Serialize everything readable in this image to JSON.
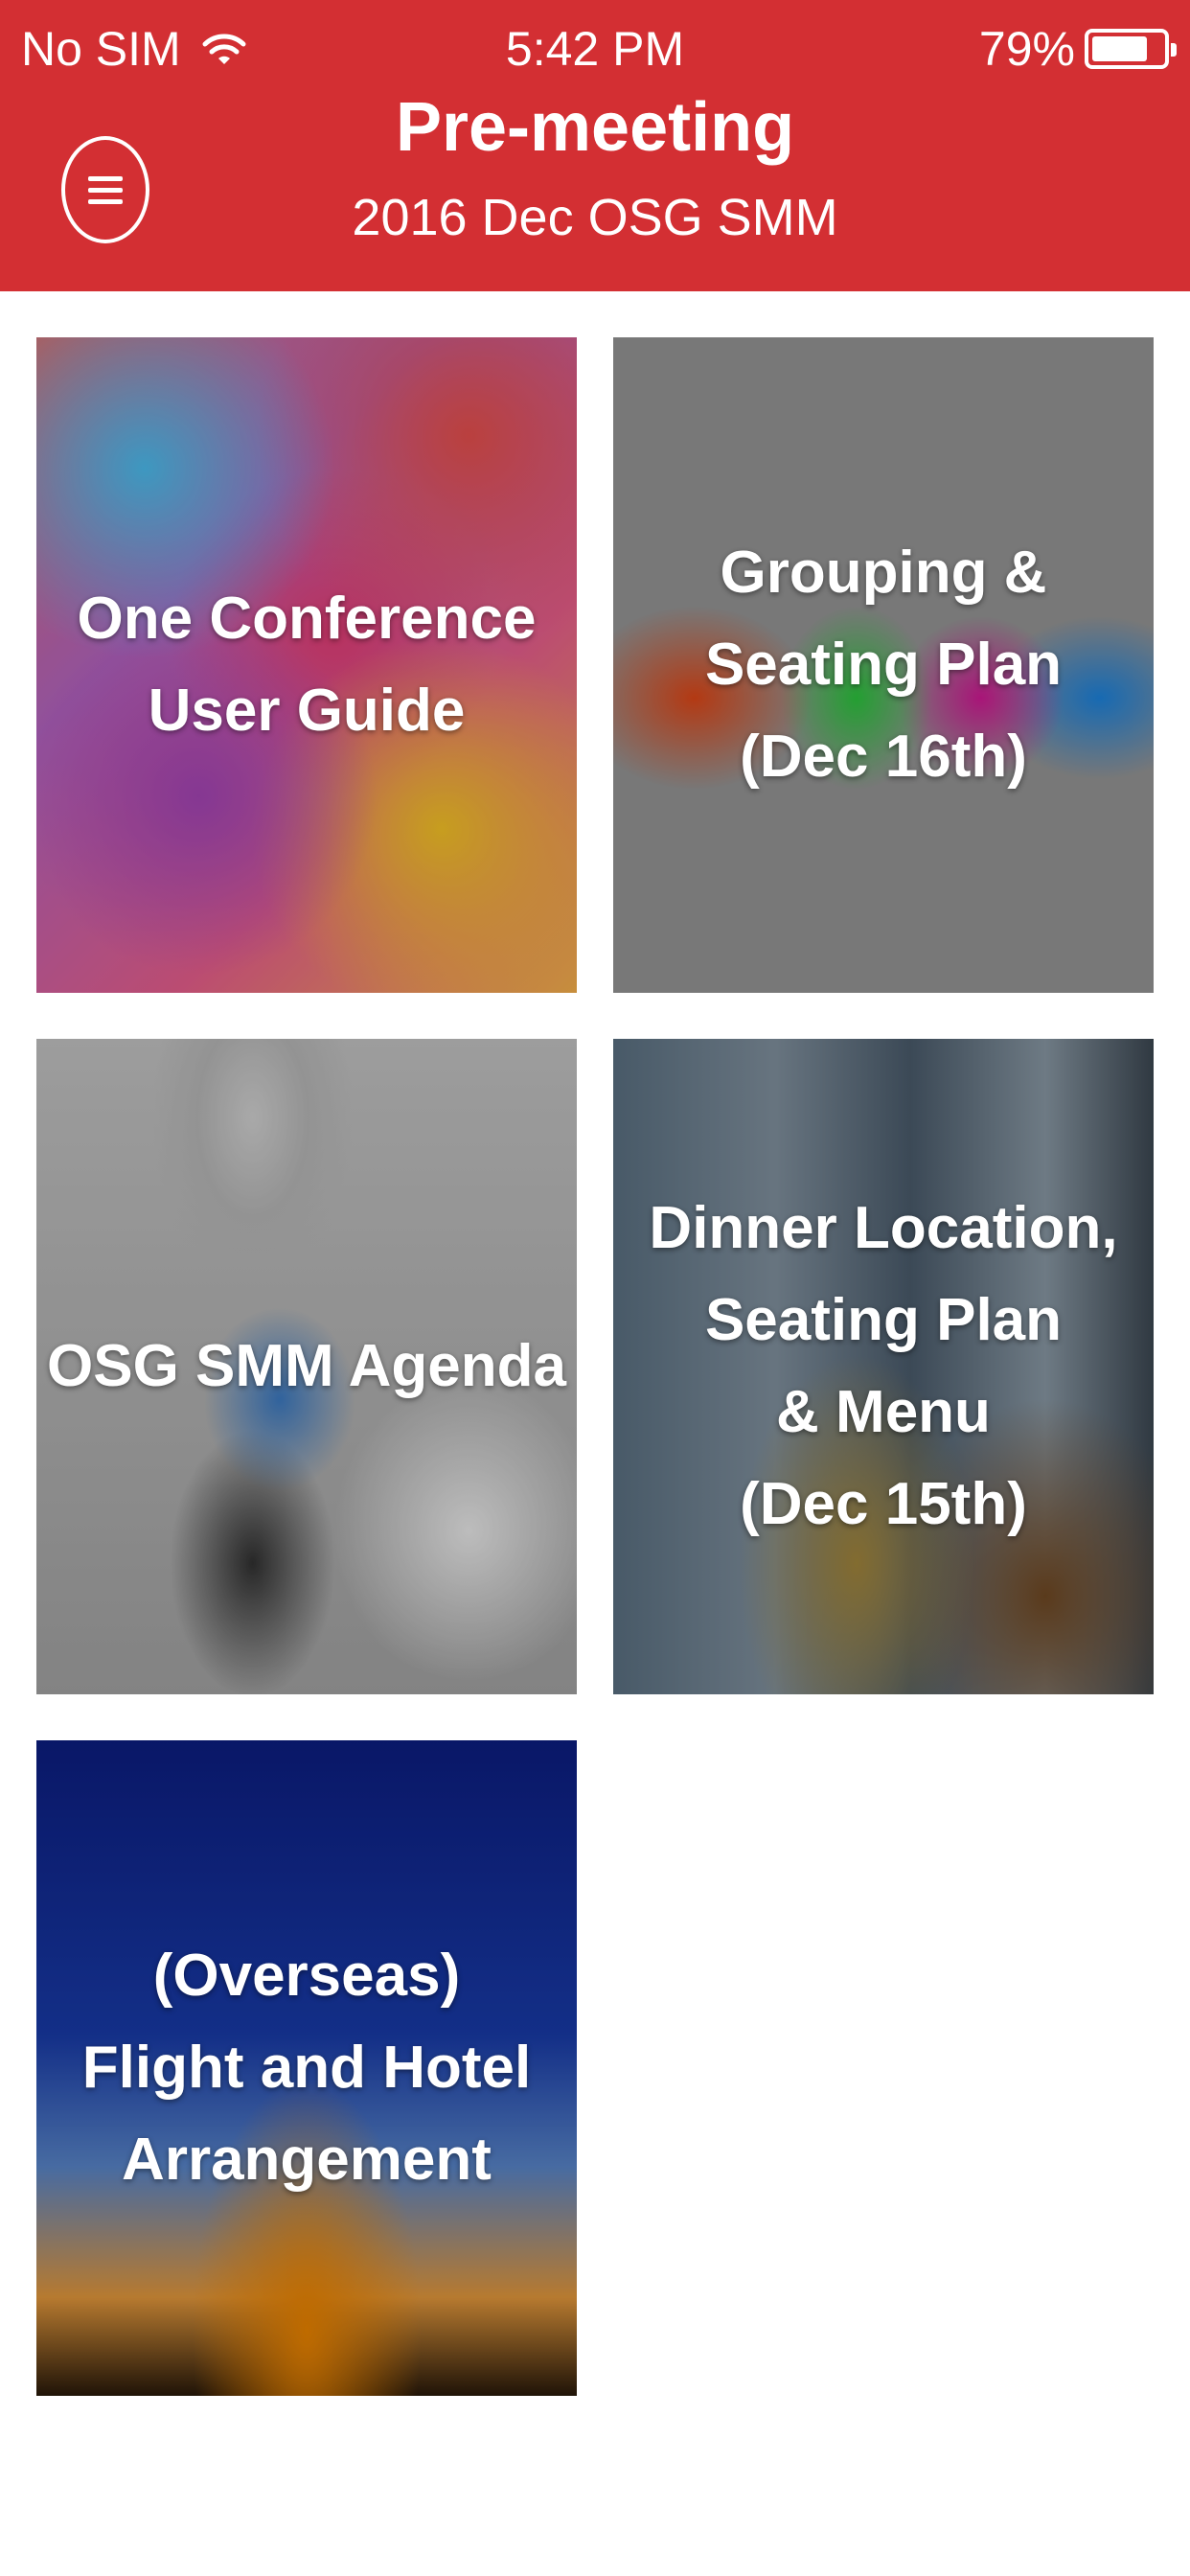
{
  "status_bar": {
    "carrier": "No SIM",
    "time": "5:42 PM",
    "battery": "79%",
    "battery_level": 0.79
  },
  "header": {
    "title": "Pre-meeting",
    "subtitle": "2016 Dec OSG SMM",
    "menu_icon": "hamburger-menu-icon",
    "background_color": "#d32f33"
  },
  "tiles": [
    {
      "label": "One Conference\nUser Guide"
    },
    {
      "label": "Grouping &\nSeating Plan\n(Dec 16th)"
    },
    {
      "label": "OSG SMM Agenda"
    },
    {
      "label": "Dinner Location,\nSeating Plan\n& Menu\n(Dec 15th)"
    },
    {
      "label": "(Overseas)\nFlight and Hotel\nArrangement"
    }
  ]
}
